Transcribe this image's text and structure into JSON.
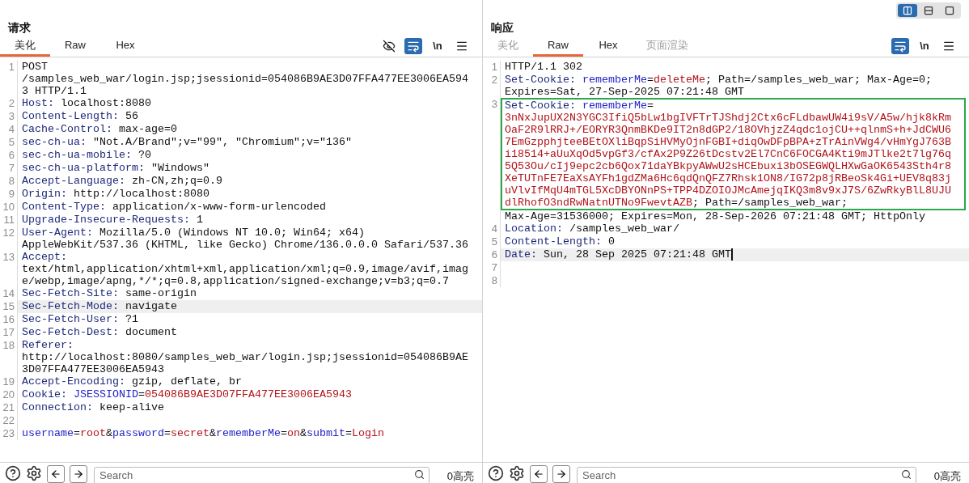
{
  "view_modes": [
    {
      "kind": "columns",
      "selected": true
    },
    {
      "kind": "rows",
      "selected": false
    },
    {
      "kind": "single",
      "selected": false
    }
  ],
  "panels": [
    {
      "title": "请求",
      "caret": false,
      "tabs": [
        {
          "label": "美化",
          "selected": true,
          "disabled": false
        },
        {
          "label": "Raw",
          "selected": false,
          "disabled": false
        },
        {
          "label": "Hex",
          "selected": false,
          "disabled": false
        }
      ],
      "tools": [
        {
          "kind": "eye-off",
          "selected": false
        },
        {
          "kind": "wrap",
          "selected": true
        },
        {
          "kind": "newline",
          "label": "\\n",
          "selected": false
        },
        {
          "kind": "menu",
          "selected": false
        }
      ],
      "lines": [
        {
          "number": "1",
          "current": false,
          "rows": [
            {
              "segments": [
                {
                  "kind": "text",
                  "text": "POST"
                }
              ]
            },
            {
              "segments": [
                {
                  "kind": "text",
                  "text": "/samples_web_war/login.jsp;jsessionid=054086B9AE3D07FFA477EE3006EA594"
                }
              ]
            },
            {
              "segments": [
                {
                  "kind": "text",
                  "text": "3 HTTP/1.1"
                }
              ]
            }
          ]
        },
        {
          "number": "2",
          "current": false,
          "rows": [
            {
              "segments": [
                {
                  "kind": "name",
                  "text": "Host:"
                },
                {
                  "kind": "text",
                  "text": " localhost:8080"
                }
              ]
            }
          ]
        },
        {
          "number": "3",
          "current": false,
          "rows": [
            {
              "segments": [
                {
                  "kind": "name",
                  "text": "Content-Length:"
                },
                {
                  "kind": "text",
                  "text": " 56"
                }
              ]
            }
          ]
        },
        {
          "number": "4",
          "current": false,
          "rows": [
            {
              "segments": [
                {
                  "kind": "name",
                  "text": "Cache-Control:"
                },
                {
                  "kind": "text",
                  "text": " max-age=0"
                }
              ]
            }
          ]
        },
        {
          "number": "5",
          "current": false,
          "rows": [
            {
              "segments": [
                {
                  "kind": "name",
                  "text": "sec-ch-ua:"
                },
                {
                  "kind": "text",
                  "text": " \"Not.A/Brand\";v=\"99\", \"Chromium\";v=\"136\""
                }
              ]
            }
          ]
        },
        {
          "number": "6",
          "current": false,
          "rows": [
            {
              "segments": [
                {
                  "kind": "name",
                  "text": "sec-ch-ua-mobile:"
                },
                {
                  "kind": "text",
                  "text": " ?0"
                }
              ]
            }
          ]
        },
        {
          "number": "7",
          "current": false,
          "rows": [
            {
              "segments": [
                {
                  "kind": "name",
                  "text": "sec-ch-ua-platform:"
                },
                {
                  "kind": "text",
                  "text": " \"Windows\""
                }
              ]
            }
          ]
        },
        {
          "number": "8",
          "current": false,
          "rows": [
            {
              "segments": [
                {
                  "kind": "name",
                  "text": "Accept-Language:"
                },
                {
                  "kind": "text",
                  "text": " zh-CN,zh;q=0.9"
                }
              ]
            }
          ]
        },
        {
          "number": "9",
          "current": false,
          "rows": [
            {
              "segments": [
                {
                  "kind": "name",
                  "text": "Origin:"
                },
                {
                  "kind": "text",
                  "text": " http://localhost:8080"
                }
              ]
            }
          ]
        },
        {
          "number": "10",
          "current": false,
          "rows": [
            {
              "segments": [
                {
                  "kind": "name",
                  "text": "Content-Type:"
                },
                {
                  "kind": "text",
                  "text": " application/x-www-form-urlencoded"
                }
              ]
            }
          ]
        },
        {
          "number": "11",
          "current": false,
          "rows": [
            {
              "segments": [
                {
                  "kind": "name",
                  "text": "Upgrade-Insecure-Requests:"
                },
                {
                  "kind": "text",
                  "text": " 1"
                }
              ]
            }
          ]
        },
        {
          "number": "12",
          "current": false,
          "rows": [
            {
              "segments": [
                {
                  "kind": "name",
                  "text": "User-Agent:"
                },
                {
                  "kind": "text",
                  "text": " Mozilla/5.0 (Windows NT 10.0; Win64; x64)"
                }
              ]
            },
            {
              "segments": [
                {
                  "kind": "text",
                  "text": "AppleWebKit/537.36 (KHTML, like Gecko) Chrome/136.0.0.0 Safari/537.36"
                }
              ]
            }
          ]
        },
        {
          "number": "13",
          "current": false,
          "rows": [
            {
              "segments": [
                {
                  "kind": "name",
                  "text": "Accept:"
                }
              ]
            },
            {
              "segments": [
                {
                  "kind": "text",
                  "text": "text/html,application/xhtml+xml,application/xml;q=0.9,image/avif,imag"
                }
              ]
            },
            {
              "segments": [
                {
                  "kind": "text",
                  "text": "e/webp,image/apng,*/*;q=0.8,application/signed-exchange;v=b3;q=0.7"
                }
              ]
            }
          ]
        },
        {
          "number": "14",
          "current": false,
          "rows": [
            {
              "segments": [
                {
                  "kind": "name",
                  "text": "Sec-Fetch-Site:"
                },
                {
                  "kind": "text",
                  "text": " same-origin"
                }
              ]
            }
          ]
        },
        {
          "number": "15",
          "current": true,
          "rows": [
            {
              "segments": [
                {
                  "kind": "name",
                  "text": "Sec-Fetch-Mode:"
                },
                {
                  "kind": "text",
                  "text": " navigate"
                }
              ]
            }
          ]
        },
        {
          "number": "16",
          "current": false,
          "rows": [
            {
              "segments": [
                {
                  "kind": "name",
                  "text": "Sec-Fetch-User:"
                },
                {
                  "kind": "text",
                  "text": " ?1"
                }
              ]
            }
          ]
        },
        {
          "number": "17",
          "current": false,
          "rows": [
            {
              "segments": [
                {
                  "kind": "name",
                  "text": "Sec-Fetch-Dest:"
                },
                {
                  "kind": "text",
                  "text": " document"
                }
              ]
            }
          ]
        },
        {
          "number": "18",
          "current": false,
          "rows": [
            {
              "segments": [
                {
                  "kind": "name",
                  "text": "Referer:"
                }
              ]
            },
            {
              "segments": [
                {
                  "kind": "text",
                  "text": "http://localhost:8080/samples_web_war/login.jsp;jsessionid=054086B9AE"
                }
              ]
            },
            {
              "segments": [
                {
                  "kind": "text",
                  "text": "3D07FFA477EE3006EA5943"
                }
              ]
            }
          ]
        },
        {
          "number": "19",
          "current": false,
          "rows": [
            {
              "segments": [
                {
                  "kind": "name",
                  "text": "Accept-Encoding:"
                },
                {
                  "kind": "text",
                  "text": " gzip, deflate, br"
                }
              ]
            }
          ]
        },
        {
          "number": "20",
          "current": false,
          "rows": [
            {
              "segments": [
                {
                  "kind": "name",
                  "text": "Cookie: "
                },
                {
                  "kind": "key",
                  "text": "JSESSIONID"
                },
                {
                  "kind": "text",
                  "text": "="
                },
                {
                  "kind": "value",
                  "text": "054086B9AE3D07FFA477EE3006EA5943"
                }
              ]
            }
          ]
        },
        {
          "number": "21",
          "current": false,
          "rows": [
            {
              "segments": [
                {
                  "kind": "name",
                  "text": "Connection:"
                },
                {
                  "kind": "text",
                  "text": " keep-alive"
                }
              ]
            }
          ]
        },
        {
          "number": "22",
          "current": false
        },
        {
          "number": "23",
          "current": false,
          "rows": [
            {
              "segments": [
                {
                  "kind": "key",
                  "text": "username"
                },
                {
                  "kind": "text",
                  "text": "="
                },
                {
                  "kind": "value",
                  "text": "root"
                },
                {
                  "kind": "text",
                  "text": "&"
                },
                {
                  "kind": "key",
                  "text": "password"
                },
                {
                  "kind": "text",
                  "text": "="
                },
                {
                  "kind": "value",
                  "text": "secret"
                },
                {
                  "kind": "text",
                  "text": "&"
                },
                {
                  "kind": "key",
                  "text": "rememberMe"
                },
                {
                  "kind": "text",
                  "text": "="
                },
                {
                  "kind": "value",
                  "text": "on"
                },
                {
                  "kind": "text",
                  "text": "&"
                },
                {
                  "kind": "key",
                  "text": "submit"
                },
                {
                  "kind": "text",
                  "text": "="
                },
                {
                  "kind": "value",
                  "text": "Login"
                }
              ]
            }
          ]
        }
      ],
      "search": {
        "placeholder": "Search"
      },
      "highlights": "0高亮"
    },
    {
      "title": "响应",
      "caret": true,
      "tabs": [
        {
          "label": "美化",
          "selected": false,
          "disabled": true
        },
        {
          "label": "Raw",
          "selected": true,
          "disabled": false
        },
        {
          "label": "Hex",
          "selected": false,
          "disabled": false
        },
        {
          "label": "页面渲染",
          "selected": false,
          "disabled": true
        }
      ],
      "tools": [
        {
          "kind": "wrap",
          "selected": true
        },
        {
          "kind": "newline",
          "label": "\\n",
          "selected": false
        },
        {
          "kind": "menu",
          "selected": false
        }
      ],
      "lines": [
        {
          "number": "1",
          "current": false,
          "rows": [
            {
              "segments": [
                {
                  "kind": "text",
                  "text": "HTTP/1.1 302"
                }
              ]
            }
          ]
        },
        {
          "number": "2",
          "current": false,
          "rows": [
            {
              "segments": [
                {
                  "kind": "name",
                  "text": "Set-Cookie: "
                },
                {
                  "kind": "key",
                  "text": "rememberMe"
                },
                {
                  "kind": "text",
                  "text": "="
                },
                {
                  "kind": "value",
                  "text": "deleteMe"
                },
                {
                  "kind": "text",
                  "text": "; Path=/samples_web_war; Max-Age=0;"
                }
              ]
            },
            {
              "segments": [
                {
                  "kind": "text",
                  "text": "Expires=Sat, 27-Sep-2025 07:21:48 GMT"
                }
              ]
            }
          ]
        },
        {
          "number": "3",
          "current": false,
          "rows": [
            {
              "highlighted": true,
              "segments": [
                {
                  "kind": "name",
                  "text": "Set-Cookie: "
                },
                {
                  "kind": "key",
                  "text": "rememberMe"
                },
                {
                  "kind": "text",
                  "text": "="
                }
              ]
            },
            {
              "highlighted": true,
              "segments": [
                {
                  "kind": "value",
                  "text": "3nNxJupUX2N3YGC3IfiQ5bLw1bgIVFTrTJShdj2Ctx6cFLdbawUW4i9sV/A5w/hjk8kRm"
                }
              ]
            },
            {
              "highlighted": true,
              "segments": [
                {
                  "kind": "value",
                  "text": "OaF2R9lRRJ+/EORYR3QnmBKDe9IT2n8dGP2/18OVhjzZ4qdc1ojCU++qlnmS+h+JdCWU6"
                }
              ]
            },
            {
              "highlighted": true,
              "segments": [
                {
                  "kind": "value",
                  "text": "7EmGzpphjteeBEtOXliBqpSiHVMyOjnFGBI+diqOwDFpBPA+zTrAinVWg4/vHmYgJ763B"
                }
              ]
            },
            {
              "highlighted": true,
              "segments": [
                {
                  "kind": "value",
                  "text": "i18514+aUuXqOd5vpGf3/cfAx2P9Z26tDcstv2El7CnC6FOCGA4Kti9mJTlke2t7lg76q"
                }
              ]
            },
            {
              "highlighted": true,
              "segments": [
                {
                  "kind": "value",
                  "text": "5Q53Ou/cIj9epc2cb6Qox71daYBkpyAWwU2sHCEbuxi3bOSEGWQLHXwGaOK6543Sth4r8"
                }
              ]
            },
            {
              "highlighted": true,
              "segments": [
                {
                  "kind": "value",
                  "text": "XeTUTnFE7EaXsAYFh1gdZMa6Hc6qdQnQFZ7Rhsk1ON8/IG72p8jRBeoSk4Gi+UEV8q83j"
                }
              ]
            },
            {
              "highlighted": true,
              "segments": [
                {
                  "kind": "value",
                  "text": "uVlvIfMqU4mTGL5XcDBYONnPS+TPP4DZOIOJMcAmejqIKQ3m8v9xJ7S/6ZwRkyBlL8UJU"
                }
              ]
            },
            {
              "highlighted": true,
              "segments": [
                {
                  "kind": "value",
                  "text": "dlRhofO3ndRwNatnUTNo9FwevtAZB"
                },
                {
                  "kind": "text",
                  "text": "; Path=/samples_web_war;"
                }
              ]
            },
            {
              "highlighted": false,
              "segments": [
                {
                  "kind": "text",
                  "text": "Max-Age=31536000; Expires=Mon, 28-Sep-2026 07:21:48 GMT; HttpOnly"
                }
              ]
            }
          ]
        },
        {
          "number": "4",
          "current": false,
          "rows": [
            {
              "segments": [
                {
                  "kind": "name",
                  "text": "Location:"
                },
                {
                  "kind": "text",
                  "text": " /samples_web_war/"
                }
              ]
            }
          ]
        },
        {
          "number": "5",
          "current": false,
          "rows": [
            {
              "segments": [
                {
                  "kind": "name",
                  "text": "Content-Length:"
                },
                {
                  "kind": "text",
                  "text": " 0"
                }
              ]
            }
          ]
        },
        {
          "number": "6",
          "current": true,
          "rows": [
            {
              "segments": [
                {
                  "kind": "name",
                  "text": "Date:"
                },
                {
                  "kind": "text",
                  "text": " Sun, 28 Sep 2025 07:21:48 GMT"
                }
              ]
            }
          ]
        },
        {
          "number": "7",
          "current": false
        },
        {
          "number": "8",
          "current": false
        }
      ],
      "search": {
        "placeholder": "Search"
      },
      "highlights": "0高亮"
    }
  ]
}
